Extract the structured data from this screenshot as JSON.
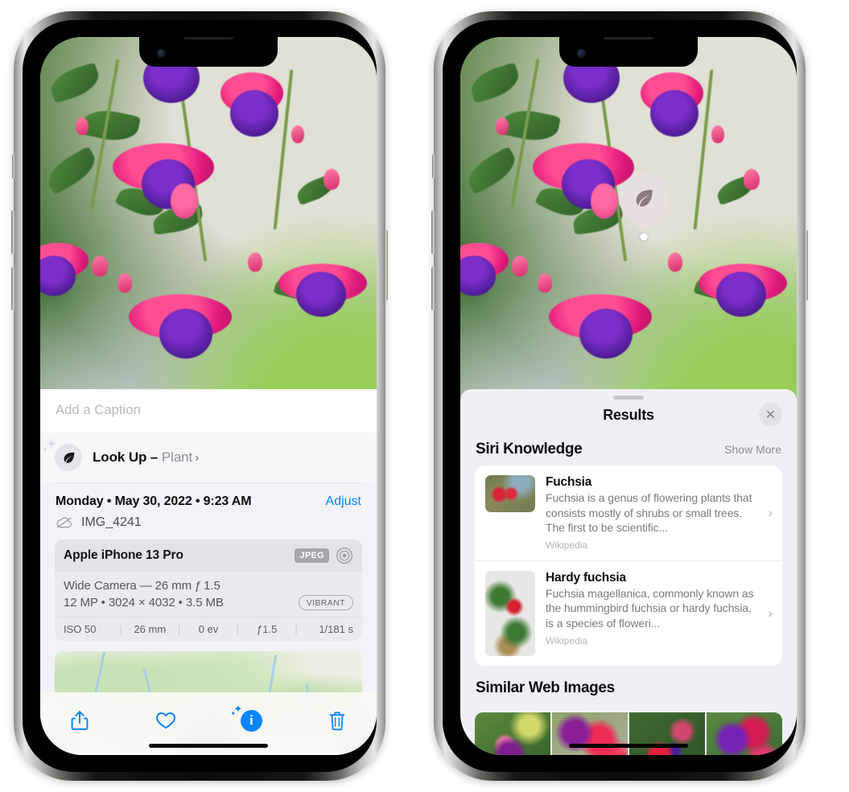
{
  "left_phone": {
    "caption_placeholder": "Add a Caption",
    "lookup": {
      "label": "Look Up – ",
      "subject": "Plant",
      "chevron": "›",
      "icon": "leaf-icon"
    },
    "date": "Monday • May 30, 2022 • 9:23 AM",
    "adjust_label": "Adjust",
    "file_name": "IMG_4241",
    "exif": {
      "device": "Apple iPhone 13 Pro",
      "format_badge": "JPEG",
      "lens_line": "Wide Camera — 26 mm ƒ 1.5",
      "size_line": "12 MP • 3024 × 4032 • 3.5 MB",
      "style_badge": "VIBRANT",
      "stats": [
        "ISO 50",
        "26 mm",
        "0 ev",
        "ƒ1.5",
        "1/181 s"
      ]
    },
    "toolbar": {
      "share_label": "share-icon",
      "favorite_label": "heart-icon",
      "info_label": "i",
      "delete_label": "trash-icon"
    }
  },
  "right_phone": {
    "badge_icon": "leaf-icon",
    "results_title": "Results",
    "close_label": "✕",
    "siri": {
      "section_title": "Siri Knowledge",
      "show_more": "Show More",
      "items": [
        {
          "title": "Fuchsia",
          "description": "Fuchsia is a genus of flowering plants that consists mostly of shrubs or small trees. The first to be scientific...",
          "source": "Wikipedia",
          "chevron": "›"
        },
        {
          "title": "Hardy fuchsia",
          "description": "Fuchsia magellanica, commonly known as the hummingbird fuchsia or hardy fuchsia, is a species of floweri...",
          "source": "Wikipedia",
          "chevron": "›"
        }
      ]
    },
    "similar": {
      "section_title": "Similar Web Images",
      "thumbnails": [
        "web-image-1",
        "web-image-2",
        "web-image-3",
        "web-image-4"
      ]
    }
  },
  "colors": {
    "accent_blue": "#0a84ff",
    "sheet_bg": "#eff0f5",
    "info_bg": "#f2f2f7",
    "card_bg": "#ffffff",
    "secondary_text": "#8e8e93"
  }
}
